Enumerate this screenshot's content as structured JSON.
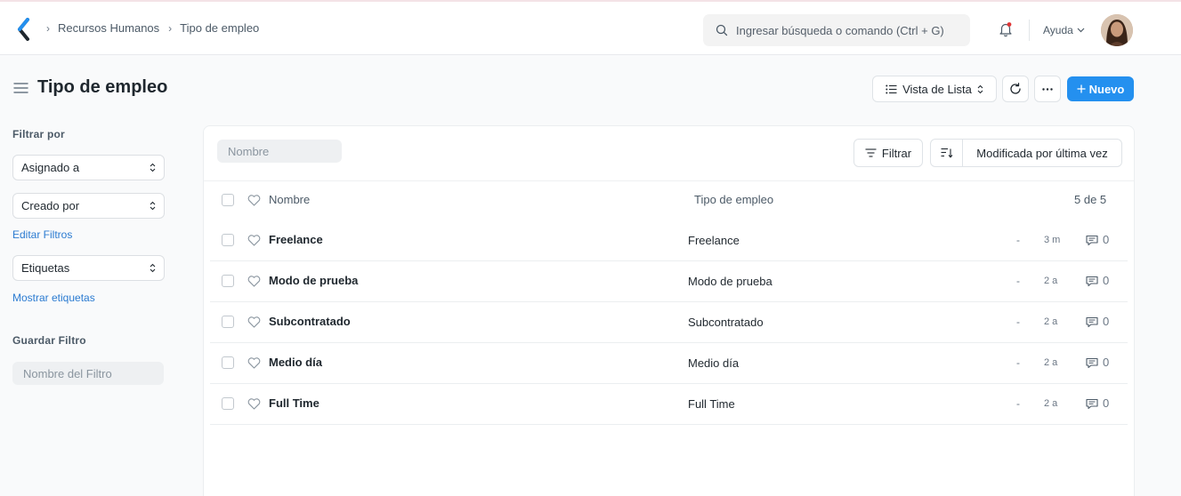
{
  "navbar": {
    "breadcrumbs": [
      "Recursos Humanos",
      "Tipo de empleo"
    ],
    "search_placeholder": "Ingresar búsqueda o comando (Ctrl + G)",
    "help_label": "Ayuda"
  },
  "page": {
    "title": "Tipo de empleo",
    "view_label": "Vista de Lista",
    "new_label": "Nuevo"
  },
  "sidebar": {
    "filter_by_label": "Filtrar por",
    "assigned_to": "Asignado a",
    "created_by": "Creado por",
    "edit_filters": "Editar Filtros",
    "tags": "Etiquetas",
    "show_tags": "Mostrar etiquetas",
    "save_filter_label": "Guardar Filtro",
    "filter_name_placeholder": "Nombre del Filtro"
  },
  "list": {
    "name_filter_placeholder": "Nombre",
    "filter_label": "Filtrar",
    "sort_label": "Modificada por última vez",
    "header": {
      "name": "Nombre",
      "type": "Tipo de empleo",
      "count": "5 de 5"
    },
    "rows": [
      {
        "name": "Freelance",
        "type": "Freelance",
        "dash": "-",
        "time": "3 m",
        "comments": "0"
      },
      {
        "name": "Modo de prueba",
        "type": "Modo de prueba",
        "dash": "-",
        "time": "2 a",
        "comments": "0"
      },
      {
        "name": "Subcontratado",
        "type": "Subcontratado",
        "dash": "-",
        "time": "2 a",
        "comments": "0"
      },
      {
        "name": "Medio día",
        "type": "Medio día",
        "dash": "-",
        "time": "2 a",
        "comments": "0"
      },
      {
        "name": "Full Time",
        "type": "Full Time",
        "dash": "-",
        "time": "2 a",
        "comments": "0"
      }
    ]
  },
  "colors": {
    "primary": "#2490ef",
    "link": "#2b7bd1",
    "notification_dot": "#e03636"
  },
  "icons": [
    "app-logo-icon",
    "chevron-right-icon",
    "search-icon",
    "bell-icon",
    "chevron-down-icon",
    "hamburger-icon",
    "list-icon",
    "sort-updown-icon",
    "refresh-icon",
    "more-icon",
    "plus-icon",
    "filter-icon",
    "sort-order-icon",
    "checkbox-icon",
    "heart-icon",
    "comment-icon"
  ]
}
